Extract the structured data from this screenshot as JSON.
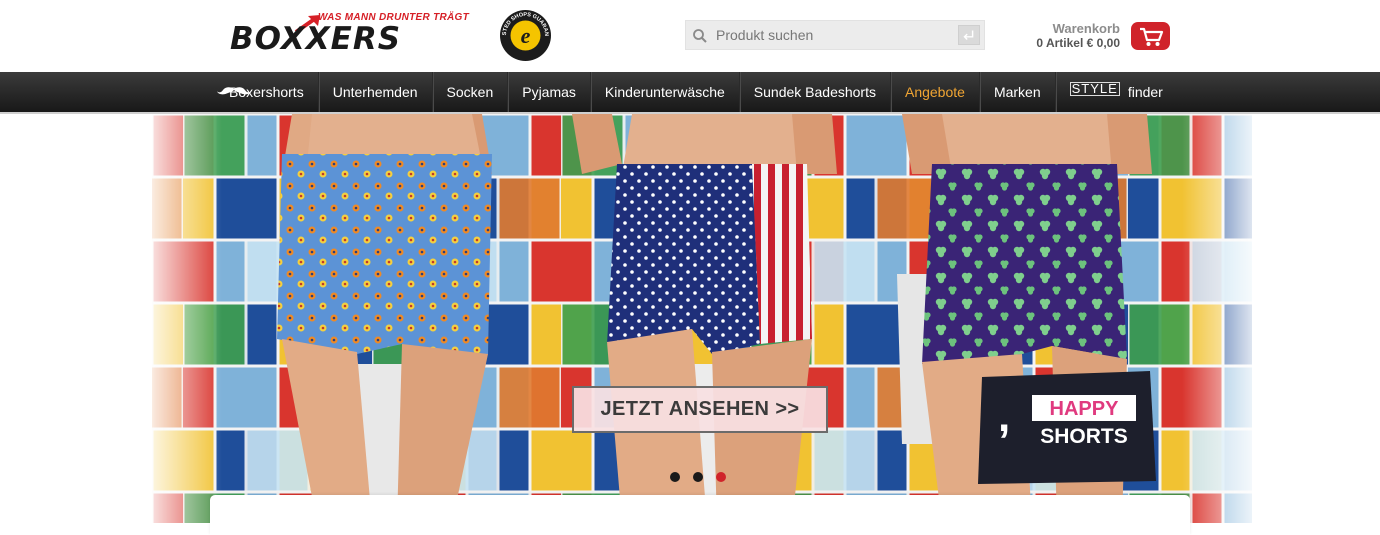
{
  "header": {
    "logo": {
      "brand": "BOXXERS",
      "tagline": "WAS MANN DRUNTER TRÄGT"
    },
    "trust_badge": {
      "letter": "e",
      "text": "TRUSTED SHOPS GUARANTEE"
    },
    "search": {
      "placeholder": "Produkt suchen",
      "value": ""
    },
    "cart": {
      "label": "Warenkorb",
      "summary": "0 Artikel € 0,00"
    }
  },
  "nav": {
    "items": [
      {
        "label": "Boxershorts"
      },
      {
        "label": "Unterhemden"
      },
      {
        "label": "Socken"
      },
      {
        "label": "Pyjamas"
      },
      {
        "label": "Kinderunterwäsche"
      },
      {
        "label": "Sundek Badeshorts"
      },
      {
        "label": "Angebote"
      },
      {
        "label": "Marken"
      }
    ],
    "style_finder": {
      "style_word": "STYLE",
      "finder_word": "finder"
    }
  },
  "hero": {
    "cta_label": "JETZT ANSEHEN >>",
    "brand_badge": {
      "mark": ",",
      "line1": "HAPPY",
      "line2": "SHORTS"
    },
    "slides": {
      "count": 3,
      "active": 3
    }
  },
  "colors": {
    "brand_red": "#d0232a",
    "nav_dark": "#1e1e1e",
    "nav_highlight": "#f0a533"
  }
}
